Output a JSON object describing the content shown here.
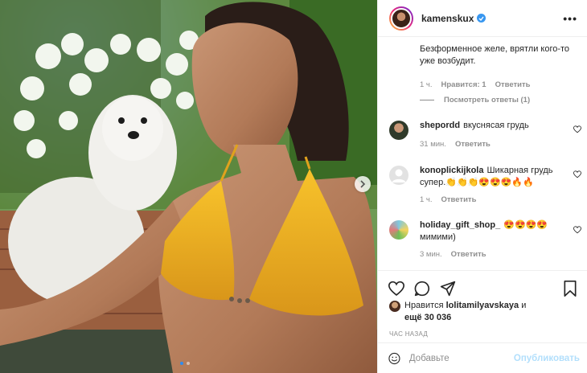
{
  "header": {
    "username": "kamenskux",
    "verified": true,
    "more_label": "•••"
  },
  "comments": [
    {
      "user": "",
      "text": "Безформенное желе, врятли кого-то уже возбудит.",
      "time": "1 ч.",
      "likes": "Нравится: 1",
      "reply": "Ответить"
    },
    {
      "view_replies": "Посмотреть ответы (1)"
    },
    {
      "user": "shepordd",
      "text": "вкусняcая грудь",
      "time": "31 мин.",
      "reply": "Ответить"
    },
    {
      "user": "konoplickijkola",
      "text": "Шикарная грудь супер.👏👏👏😍😍😍🔥🔥",
      "time": "1 ч.",
      "reply": "Ответить"
    },
    {
      "user": "holiday_gift_shop_",
      "text": "😍😍😍😍 мимими)",
      "time": "3 мин.",
      "reply": "Ответить"
    }
  ],
  "likes": {
    "prefix": "Нравится",
    "user": "lolitamilyavskaya",
    "and_more": "и",
    "more_text": "ещё 30 036"
  },
  "post_time": "ЧАС НАЗАД",
  "add_comment": {
    "placeholder": "Добавьте",
    "publish": "Опубликовать"
  },
  "colors": {
    "accent": "#3897f0",
    "publish_disabled": "#b2dffc",
    "muted": "#8e8e8e"
  },
  "carousel": {
    "slide": 1,
    "total": 2
  }
}
